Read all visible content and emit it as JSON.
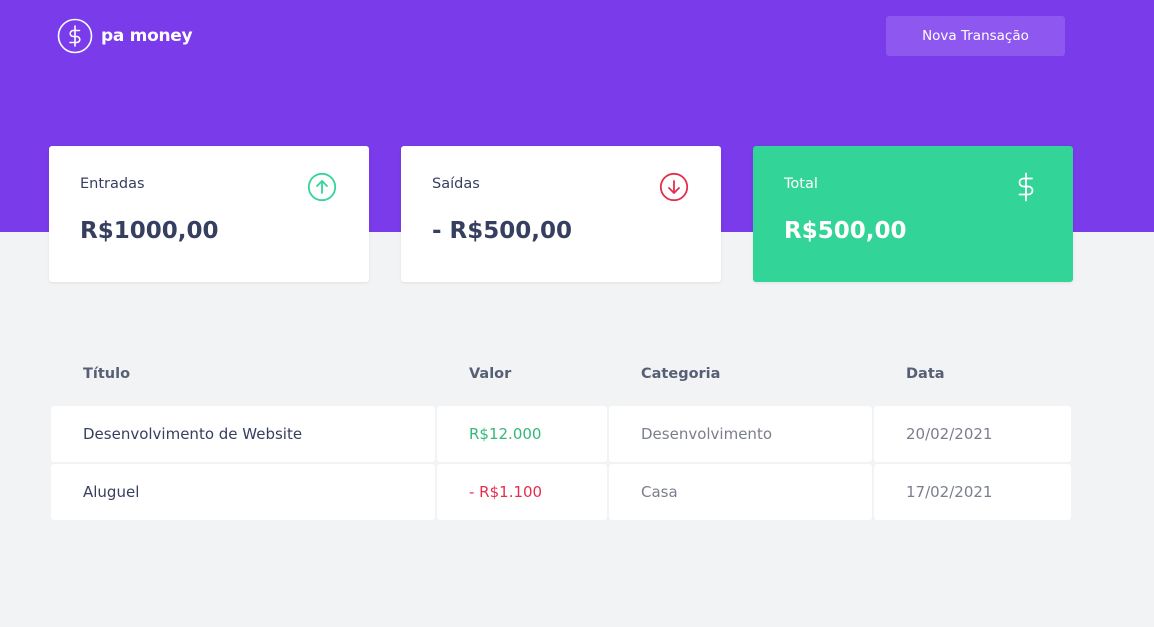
{
  "header": {
    "logo_text": "pa money",
    "logo_icon": "dollar-circle-icon",
    "new_transaction_label": "Nova Transação",
    "background_color": "#7a3bea",
    "button_color": "#8e57f0"
  },
  "summary": {
    "income": {
      "label": "Entradas",
      "value": "R$1000,00",
      "icon": "arrow-up-circle-icon",
      "icon_color": "#33d498"
    },
    "outcome": {
      "label": "Saídas",
      "value": "- R$500,00",
      "icon": "arrow-down-circle-icon",
      "icon_color": "#e52e4d"
    },
    "total": {
      "label": "Total",
      "value": "R$500,00",
      "icon": "dollar-icon",
      "background_color": "#33d498"
    }
  },
  "table": {
    "headers": [
      "Título",
      "Valor",
      "Categoria",
      "Data"
    ],
    "rows": [
      {
        "title": "Desenvolvimento de Website",
        "value": "R$12.000",
        "type": "deposit",
        "category": "Desenvolvimento",
        "date": "20/02/2021"
      },
      {
        "title": "Aluguel",
        "value": "- R$1.100",
        "type": "withdraw",
        "category": "Casa",
        "date": "17/02/2021"
      }
    ]
  }
}
